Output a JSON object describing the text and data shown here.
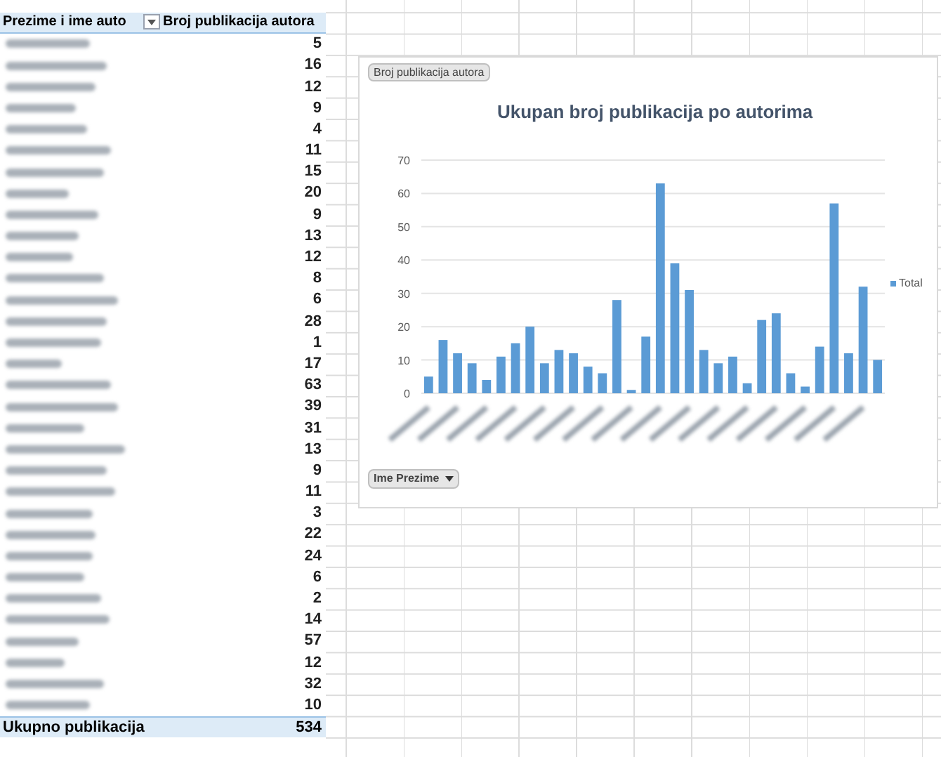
{
  "pivot": {
    "columns": [
      {
        "label": "Prezime i ime auto",
        "filter": true
      },
      {
        "label": "Broj publikacija autora",
        "filter": false
      }
    ],
    "rows": [
      {
        "value": "5"
      },
      {
        "value": "16"
      },
      {
        "value": "12"
      },
      {
        "value": "9"
      },
      {
        "value": "4"
      },
      {
        "value": "11"
      },
      {
        "value": "15"
      },
      {
        "value": "20"
      },
      {
        "value": "9"
      },
      {
        "value": "13"
      },
      {
        "value": "12"
      },
      {
        "value": "8"
      },
      {
        "value": "6"
      },
      {
        "value": "28"
      },
      {
        "value": "1"
      },
      {
        "value": "17"
      },
      {
        "value": "63"
      },
      {
        "value": "39"
      },
      {
        "value": "31"
      },
      {
        "value": "13"
      },
      {
        "value": "9"
      },
      {
        "value": "11"
      },
      {
        "value": "3"
      },
      {
        "value": "22"
      },
      {
        "value": "24"
      },
      {
        "value": "6"
      },
      {
        "value": "2"
      },
      {
        "value": "14"
      },
      {
        "value": "57"
      },
      {
        "value": "12"
      },
      {
        "value": "32"
      },
      {
        "value": "10"
      }
    ],
    "total": {
      "label": "Ukupno publikacija",
      "value": "534"
    }
  },
  "chart": {
    "field_button": "Broj publikacija autora",
    "axis_button": "Ime Prezime",
    "chart_data": {
      "type": "bar",
      "grid": true,
      "title": "Ukupan broj publikacija po autorima",
      "ylim": [
        0,
        70
      ],
      "yticks": [
        0,
        10,
        20,
        30,
        40,
        50,
        60,
        70
      ],
      "series": [
        {
          "name": "Total",
          "color": "#5b9bd5",
          "values": [
            5,
            16,
            12,
            9,
            4,
            11,
            15,
            20,
            9,
            13,
            12,
            8,
            6,
            28,
            1,
            17,
            63,
            39,
            31,
            13,
            9,
            11,
            3,
            22,
            24,
            6,
            2,
            14,
            57,
            12,
            32,
            10
          ]
        }
      ]
    }
  }
}
